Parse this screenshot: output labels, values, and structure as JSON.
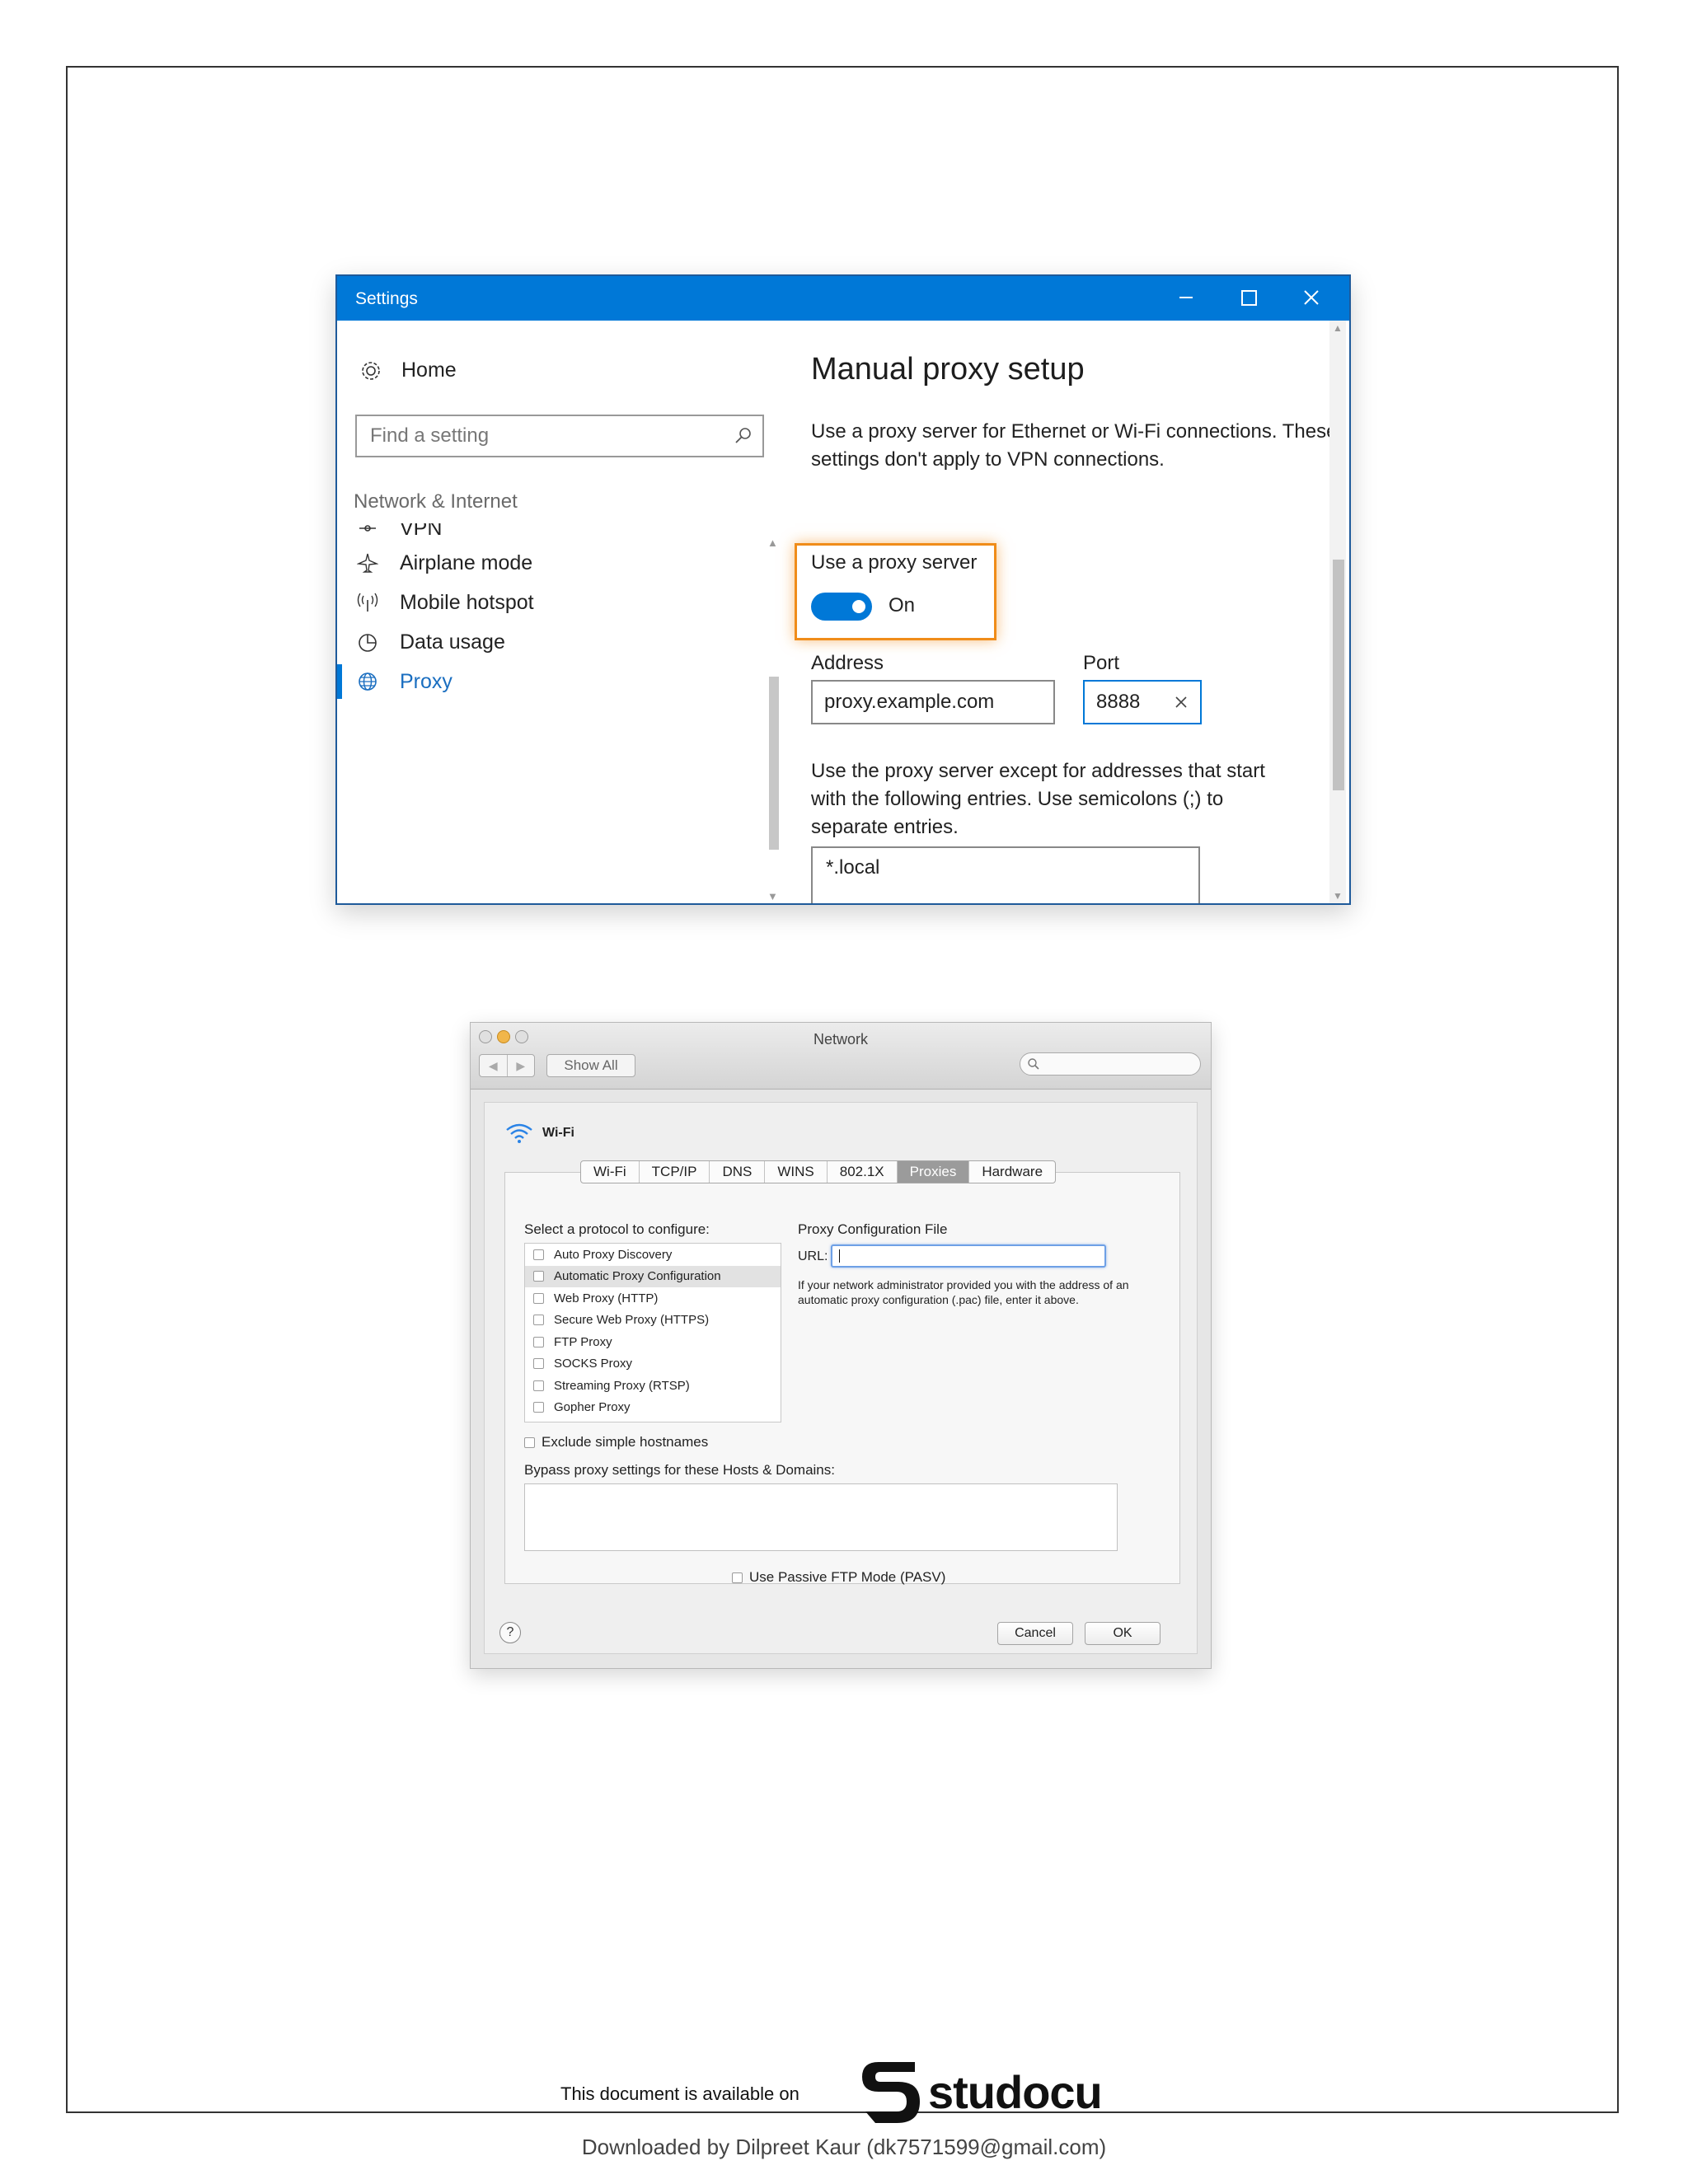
{
  "windows_settings": {
    "title": "Settings",
    "nav": {
      "home_label": "Home",
      "search_placeholder": "Find a setting",
      "group_label": "Network & Internet",
      "items": [
        {
          "label": "VPN",
          "icon": "vpn-icon"
        },
        {
          "label": "Airplane mode",
          "icon": "airplane-icon"
        },
        {
          "label": "Mobile hotspot",
          "icon": "hotspot-icon"
        },
        {
          "label": "Data usage",
          "icon": "data-usage-icon"
        },
        {
          "label": "Proxy",
          "icon": "globe-icon",
          "active": true
        }
      ]
    },
    "main": {
      "title": "Manual proxy setup",
      "description": "Use a proxy server for Ethernet or Wi-Fi connections. These settings don't apply to VPN connections.",
      "use_proxy_label": "Use a proxy server",
      "toggle_state": "On",
      "address_label": "Address",
      "address_value": "proxy.example.com",
      "port_label": "Port",
      "port_value": "8888",
      "exceptions_text": "Use the proxy server except for addresses that start with the following entries. Use semicolons (;) to separate entries.",
      "exceptions_value": "*.local"
    },
    "colors": {
      "accent": "#0078d7",
      "highlight": "#f08c19"
    }
  },
  "mac_network": {
    "title": "Network",
    "show_all_label": "Show All",
    "interface_label": "Wi-Fi",
    "tabs": [
      {
        "label": "Wi-Fi"
      },
      {
        "label": "TCP/IP"
      },
      {
        "label": "DNS"
      },
      {
        "label": "WINS"
      },
      {
        "label": "802.1X"
      },
      {
        "label": "Proxies",
        "selected": true
      },
      {
        "label": "Hardware"
      }
    ],
    "protocol_label": "Select a protocol to configure:",
    "protocols": [
      {
        "label": "Auto Proxy Discovery"
      },
      {
        "label": "Automatic Proxy Configuration",
        "selected": true
      },
      {
        "label": "Web Proxy (HTTP)"
      },
      {
        "label": "Secure Web Proxy (HTTPS)"
      },
      {
        "label": "FTP Proxy"
      },
      {
        "label": "SOCKS Proxy"
      },
      {
        "label": "Streaming Proxy (RTSP)"
      },
      {
        "label": "Gopher Proxy"
      }
    ],
    "pcf_label": "Proxy Configuration File",
    "url_label": "URL:",
    "url_value": "",
    "pcf_note": "If your network administrator provided you with the address of an automatic proxy configuration (.pac) file, enter it above.",
    "exclude_label": "Exclude simple hostnames",
    "bypass_label": "Bypass proxy settings for these Hosts & Domains:",
    "pasv_label": "Use Passive FTP Mode (PASV)",
    "help_label": "?",
    "cancel_label": "Cancel",
    "ok_label": "OK"
  },
  "footer": {
    "available_text": "This document is available on",
    "logo_text": "studocu",
    "downloaded_text": "Downloaded by Dilpreet Kaur (dk7571599@gmail.com)"
  }
}
